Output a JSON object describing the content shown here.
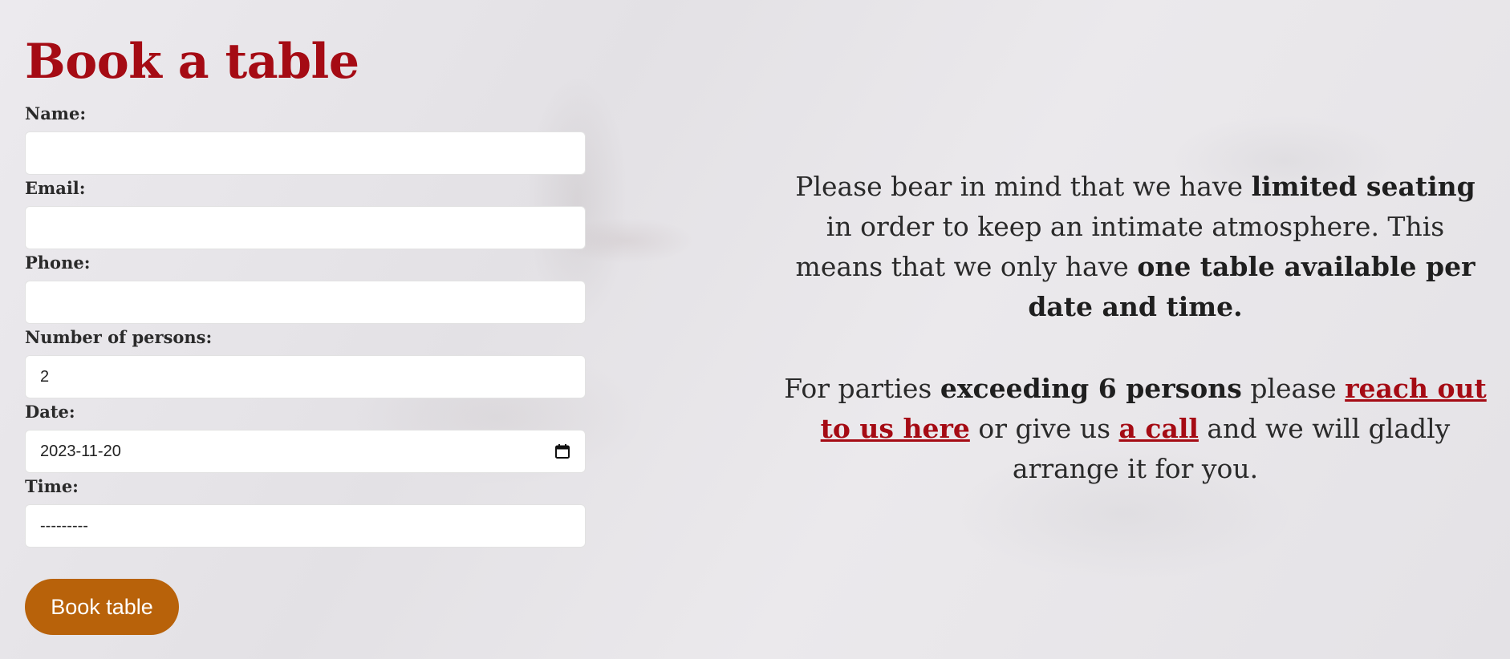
{
  "page": {
    "title": "Book a table"
  },
  "form": {
    "name": {
      "label": "Name:",
      "value": ""
    },
    "email": {
      "label": "Email:",
      "value": ""
    },
    "phone": {
      "label": "Phone:",
      "value": ""
    },
    "persons": {
      "label": "Number of persons:",
      "value": "2"
    },
    "date": {
      "label": "Date:",
      "value": "2023-11-20"
    },
    "time": {
      "label": "Time:",
      "value": "---------"
    },
    "submit_label": "Book table"
  },
  "info": {
    "p1_a": "Please bear in mind that we have ",
    "p1_b": "limited seating",
    "p1_c": " in order to keep an intimate atmosphere. This means that we only have ",
    "p1_d": "one table available per date and time.",
    "p2_a": "For parties ",
    "p2_b": "exceeding 6 persons",
    "p2_c": " please ",
    "p2_link1": "reach out to us here",
    "p2_d": " or give us ",
    "p2_link2": "a call",
    "p2_e": " and we will gladly arrange it for you."
  },
  "colors": {
    "title": "#a50b14",
    "link": "#a50b14",
    "button": "#b8620a",
    "background": "#e9e7ea"
  },
  "icons": {
    "date": "calendar-icon"
  }
}
